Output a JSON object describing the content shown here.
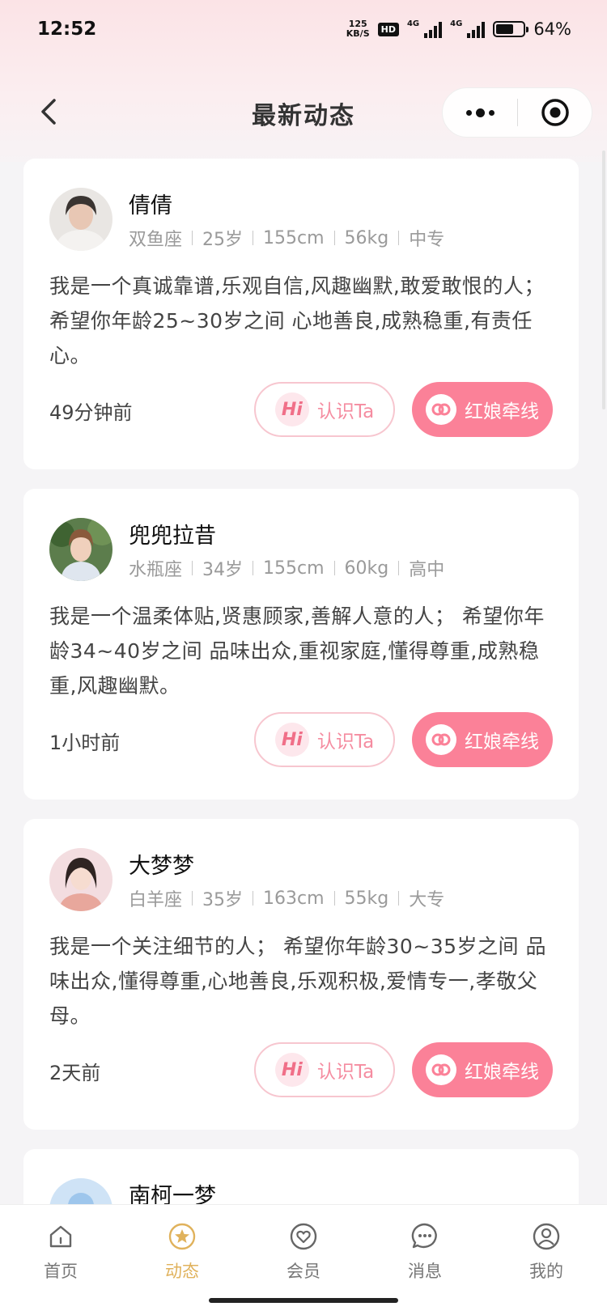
{
  "status_bar": {
    "time": "12:52",
    "net_speed_value": "125",
    "net_speed_unit": "KB/S",
    "hd_label": "HD",
    "net_type_1": "4G",
    "net_type_2": "4G",
    "battery_level": 0.64,
    "battery_label": "64%"
  },
  "nav": {
    "title": "最新动态"
  },
  "posts": [
    {
      "name": "倩倩",
      "zodiac": "双鱼座",
      "age": "25岁",
      "height": "155cm",
      "weight": "56kg",
      "education": "中专",
      "bio": "我是一个真诚靠谱,乐观自信,风趣幽默,敢爱敢恨的人；  希望你年龄25~30岁之间 心地善良,成熟稳重,有责任心。",
      "time": "49分钟前"
    },
    {
      "name": "兜兜拉昔",
      "zodiac": "水瓶座",
      "age": "34岁",
      "height": "155cm",
      "weight": "60kg",
      "education": "高中",
      "bio": "我是一个温柔体贴,贤惠顾家,善解人意的人；  希望你年龄34~40岁之间 品味出众,重视家庭,懂得尊重,成熟稳重,风趣幽默。",
      "time": "1小时前"
    },
    {
      "name": "大梦梦",
      "zodiac": "白羊座",
      "age": "35岁",
      "height": "163cm",
      "weight": "55kg",
      "education": "大专",
      "bio": "我是一个关注细节的人；  希望你年龄30~35岁之间 品味出众,懂得尊重,心地善良,乐观积极,爱情专一,孝敬父母。",
      "time": "2天前"
    },
    {
      "name": "南柯一梦"
    }
  ],
  "buttons": {
    "hi_icon_text": "Hi",
    "hi_label": "认识Ta",
    "match_label": "红娘牵线"
  },
  "tabs": [
    {
      "label": "首页",
      "icon": "home-icon"
    },
    {
      "label": "动态",
      "icon": "feed-star-icon",
      "active": true
    },
    {
      "label": "会员",
      "icon": "member-heart-icon"
    },
    {
      "label": "消息",
      "icon": "chat-bubble-icon"
    },
    {
      "label": "我的",
      "icon": "user-profile-icon"
    }
  ],
  "colors": {
    "accent_pink": "#fb8198",
    "active_tab": "#e0b25c"
  }
}
